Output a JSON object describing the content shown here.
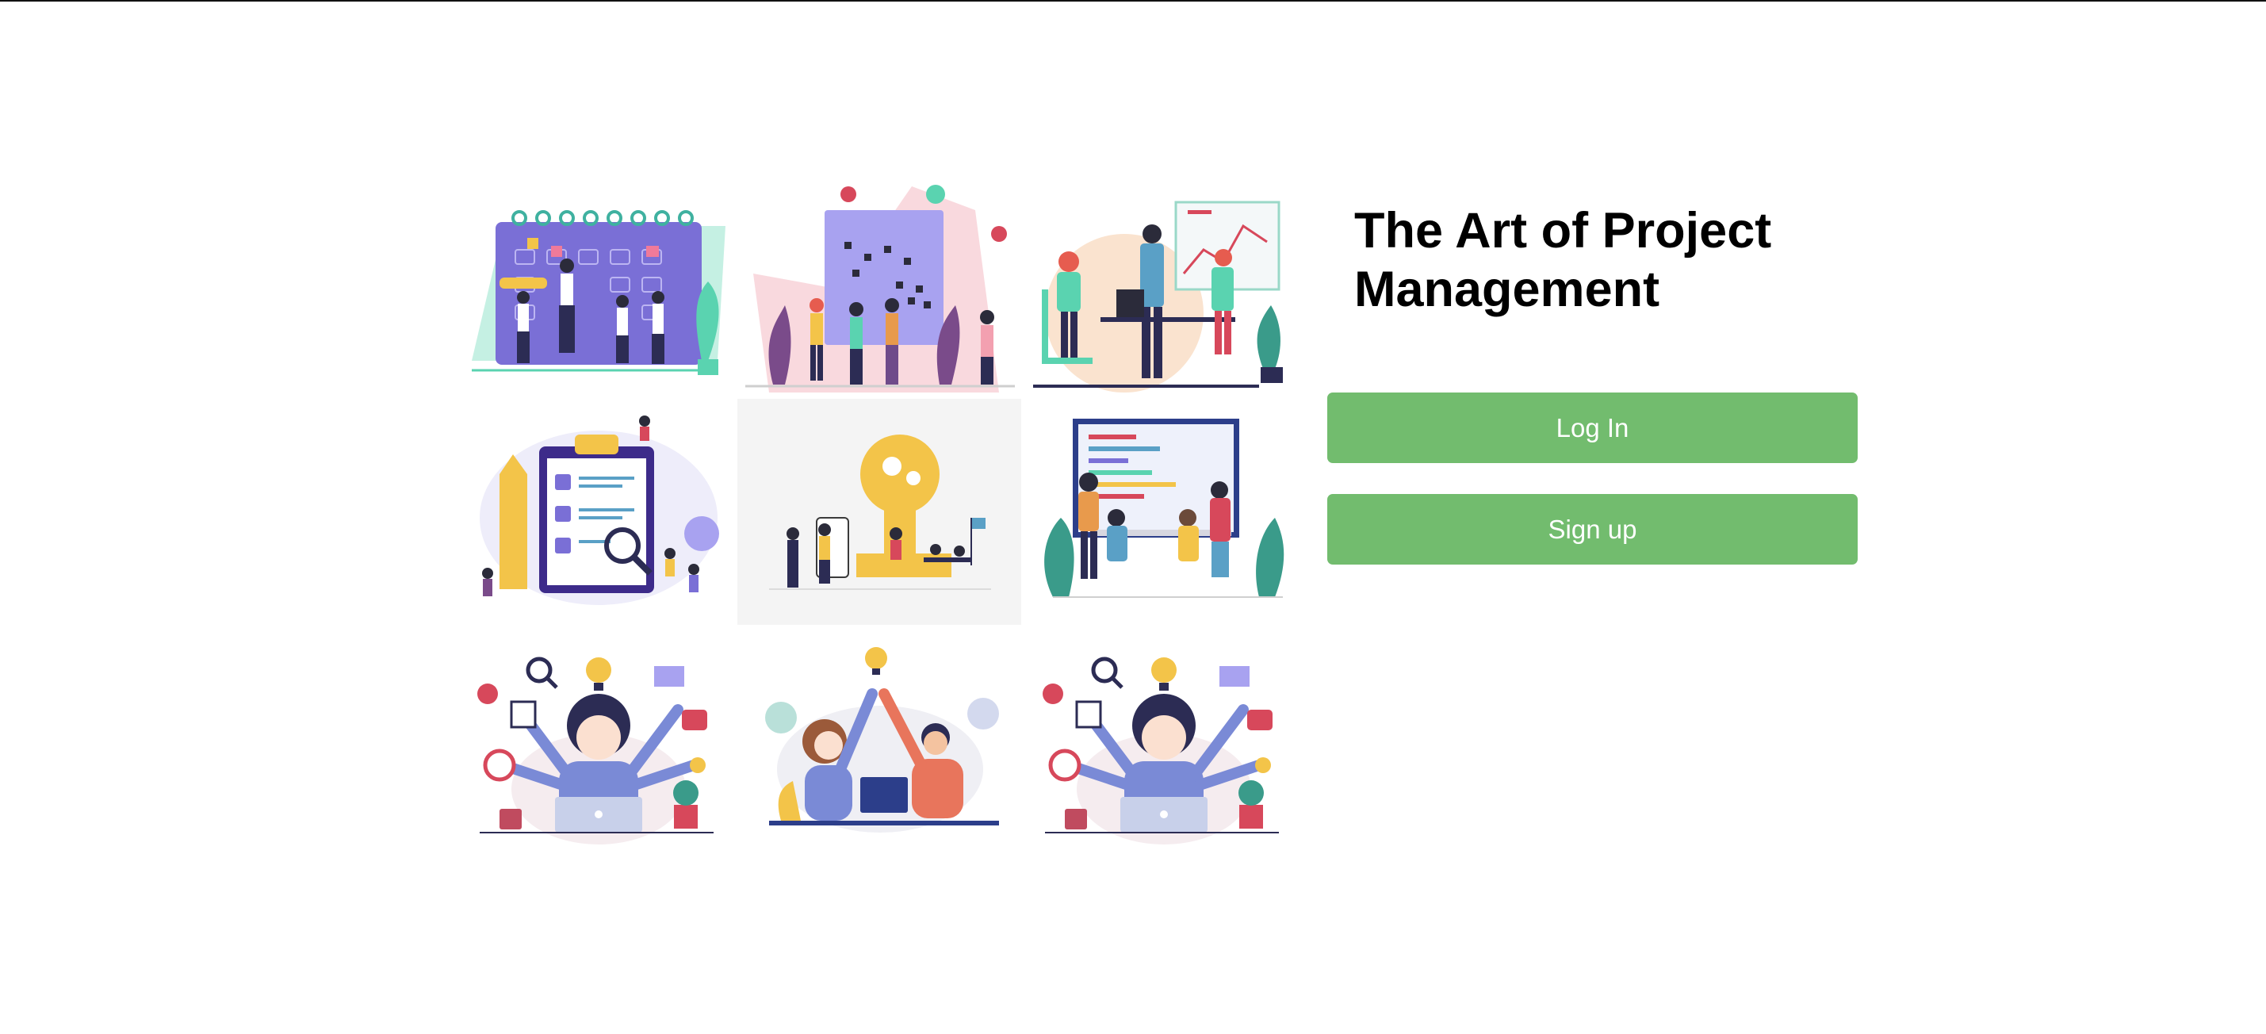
{
  "page": {
    "title": "The Art of Project Management"
  },
  "actions": {
    "login_label": "Log In",
    "signup_label": "Sign up"
  },
  "gallery": {
    "tiles": [
      {
        "icon": "calendar-team-illustration"
      },
      {
        "icon": "kanban-board-team-illustration"
      },
      {
        "icon": "office-chart-presentation-illustration"
      },
      {
        "icon": "checklist-clipboard-illustration"
      },
      {
        "icon": "lightbulb-idea-team-illustration"
      },
      {
        "icon": "dashboard-meeting-illustration"
      },
      {
        "icon": "multitasking-woman-illustration"
      },
      {
        "icon": "high-five-colleagues-illustration"
      },
      {
        "icon": "multitasking-woman-illustration"
      }
    ]
  },
  "colors": {
    "button_green": "#72bc6e",
    "accent_purple": "#7a6fd6",
    "accent_yellow": "#f3c449",
    "accent_red": "#d7485b"
  }
}
